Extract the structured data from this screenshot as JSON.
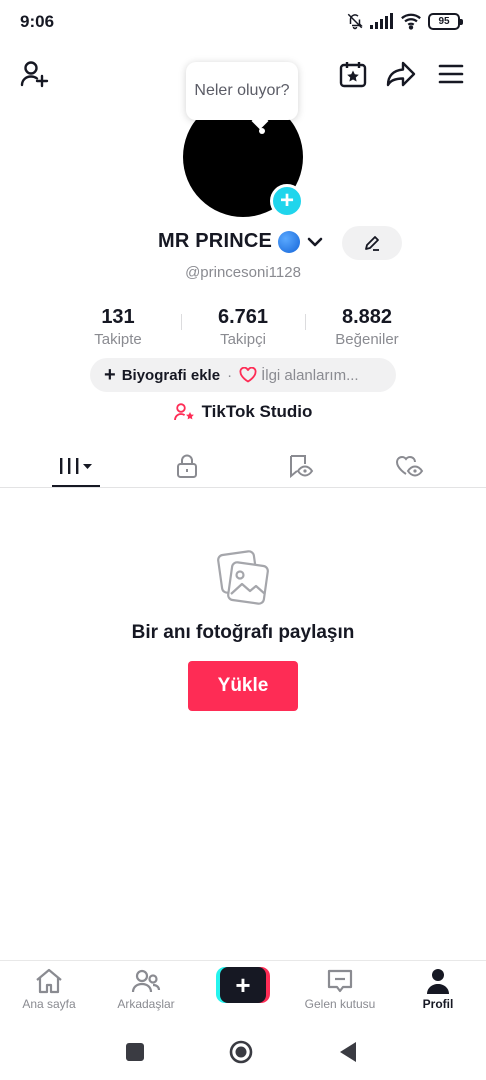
{
  "status_bar": {
    "time": "9:06",
    "battery": "95"
  },
  "bubble": {
    "text": "Neler oluyor?"
  },
  "profile": {
    "name": "MR PRINCE",
    "username": "@princesoni1128"
  },
  "stats": [
    {
      "value": "131",
      "label": "Takipte"
    },
    {
      "value": "6.761",
      "label": "Takipçi"
    },
    {
      "value": "8.882",
      "label": "Beğeniler"
    }
  ],
  "bio": {
    "plus": "+",
    "add_label": "Biyografi ekle",
    "separator": "·",
    "interests_label": "İlgi alanlarım..."
  },
  "studio": {
    "label": "TikTok Studio"
  },
  "empty_state": {
    "title": "Bir anı fotoğrafı paylaşın",
    "button": "Yükle"
  },
  "bottom_nav": {
    "home": "Ana sayfa",
    "friends": "Arkadaşlar",
    "create": "+",
    "inbox": "Gelen kutusu",
    "profile": "Profil"
  },
  "colors": {
    "accent": "#fe2c55",
    "cyan": "#25f4ee",
    "avatar_plus": "#20d5ec",
    "text": "#161823",
    "muted": "#8a8b91"
  },
  "icons": [
    "add-friend-icon",
    "calendar-star-icon",
    "share-icon",
    "menu-icon",
    "edit-pencil-icon",
    "chevron-down-icon",
    "heart-outline-icon",
    "person-star-icon",
    "grid-videos-icon",
    "lock-icon",
    "repost-eye-icon",
    "liked-eye-icon",
    "photos-icon",
    "home-icon",
    "friends-icon",
    "inbox-icon",
    "profile-icon"
  ]
}
